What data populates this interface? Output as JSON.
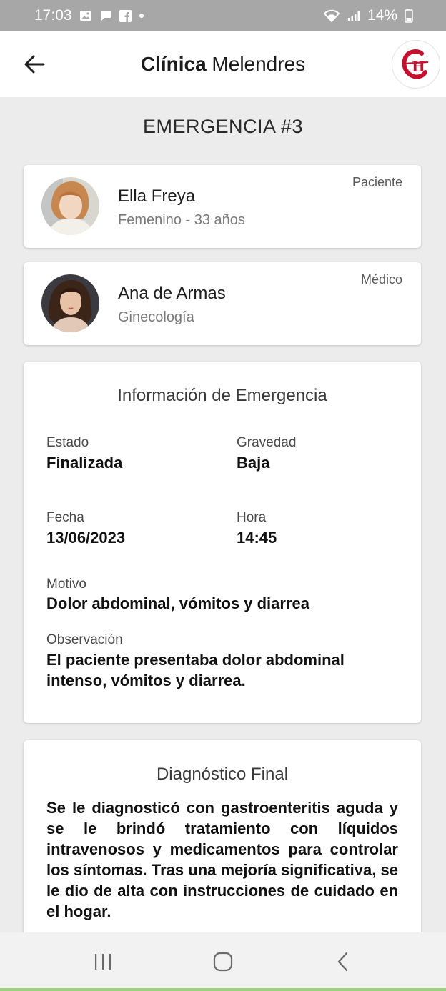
{
  "status_bar": {
    "time": "17:03",
    "battery": "14%"
  },
  "app_bar": {
    "title_bold": "Clínica",
    "title_regular": "Melendres",
    "logo_icon": "clinic-logo-icon"
  },
  "emergency": {
    "title": "EMERGENCIA #3"
  },
  "patient": {
    "name": "Ella Freya",
    "detail": "Femenino - 33 años",
    "role": "Paciente"
  },
  "doctor": {
    "name": "Ana de Armas",
    "detail": "Ginecología",
    "role": "Médico"
  },
  "info": {
    "title": "Información de Emergencia",
    "estado_label": "Estado",
    "estado_value": "Finalizada",
    "gravedad_label": "Gravedad",
    "gravedad_value": "Baja",
    "fecha_label": "Fecha",
    "fecha_value": "13/06/2023",
    "hora_label": "Hora",
    "hora_value": "14:45",
    "motivo_label": "Motivo",
    "motivo_value": "Dolor abdominal, vómitos y diarrea",
    "observacion_label": "Observación",
    "observacion_value": "El paciente presentaba dolor abdominal intenso, vómitos y diarrea."
  },
  "diagnosis": {
    "title": "Diagnóstico Final",
    "text": "Se le diagnosticó con gastroenteritis aguda y se le brindó tratamiento con líquidos intravenosos y medicamentos para controlar los síntomas. Tras una mejoría significativa, se le dio de alta con instrucciones de cuidado en el hogar."
  },
  "colors": {
    "background": "#ececec",
    "status_bar": "#a7a7a7",
    "logo_red": "#c8102e"
  }
}
